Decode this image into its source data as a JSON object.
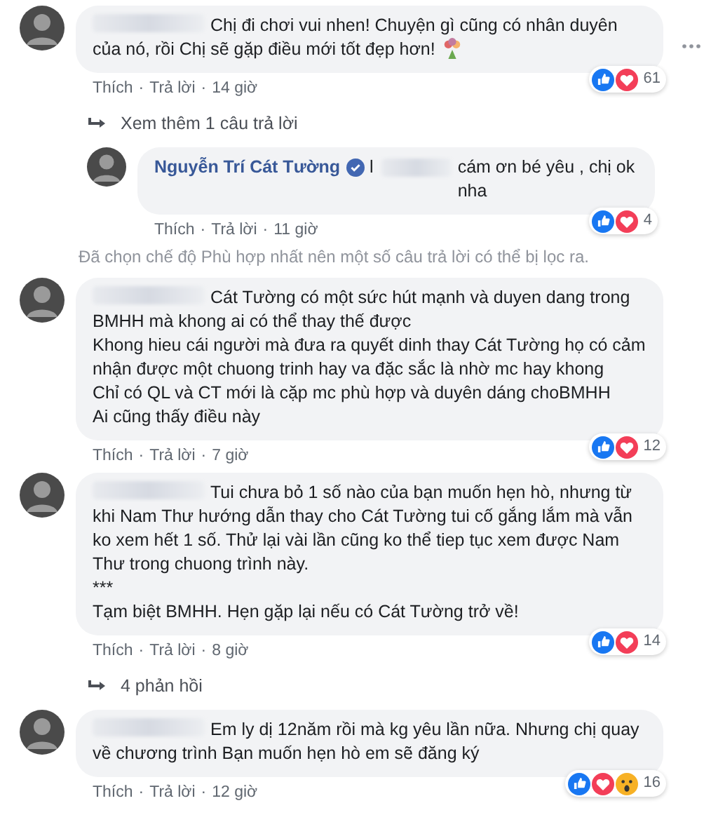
{
  "thread": [
    {
      "kind": "comment",
      "redacted_name": true,
      "text": "Chị đi chơi vui nhen! Chuyện gì cũng có nhân duyên của nó, rồi Chị sẽ gặp điều mới tốt đẹp hơn!",
      "trailing_emoji": true,
      "more_menu": true,
      "reactions": [
        {
          "kind": "like"
        },
        {
          "kind": "love"
        }
      ],
      "count": "61",
      "separators": [
        "·",
        "·"
      ],
      "like": "Thích",
      "reply": "Trả lời",
      "time": "14 giờ"
    },
    {
      "kind": "replies_link",
      "label": "Xem thêm 1 câu trả lời"
    },
    {
      "kind": "reply",
      "name": "Nguyễn Trí Cát Tường",
      "verified": true,
      "lead": "l",
      "redacted_name": true,
      "text": "cám ơn bé yêu , chị ok nha",
      "reactions": [
        {
          "kind": "like"
        },
        {
          "kind": "love"
        }
      ],
      "count": "4",
      "separators": [
        "·",
        "·"
      ],
      "like": "Thích",
      "reply": "Trả lời",
      "time": "11 giờ"
    },
    {
      "kind": "notice",
      "label": "Đã chọn chế độ Phù hợp nhất nên một số câu trả lời có thể bị lọc ra."
    },
    {
      "kind": "comment",
      "redacted_name": true,
      "text": "Cát Tường có một sức hút mạnh và duyen dang trong BMHH mà khong ai có thể thay thế được\nKhong hieu cái người mà đưa ra quyết dinh thay Cát Tường họ có cảm nhận được một chuong trinh hay va đặc sắc là nhờ mc hay khong\nChỉ có QL và CT mới là cặp mc phù hợp và duyên dáng choBMHH\nAi cũng thấy điều này",
      "reactions": [
        {
          "kind": "like"
        },
        {
          "kind": "love"
        }
      ],
      "count": "12",
      "separators": [
        "·",
        "·"
      ],
      "like": "Thích",
      "reply": "Trả lời",
      "time": "7 giờ"
    },
    {
      "kind": "comment",
      "redacted_name": true,
      "text": "Tui chưa bỏ 1 số nào của bạn muốn hẹn hò, nhưng từ khi Nam Thư hướng dẫn thay cho Cát Tường tui cố gắng lắm mà vẫn ko xem hết 1 số. Thử lại vài lần cũng ko thể tiep tục xem được Nam Thư trong chuong trình này.\n***\nTạm biệt BMHH. Hẹn gặp lại nếu có Cát Tường trở về!",
      "reactions": [
        {
          "kind": "like"
        },
        {
          "kind": "love"
        }
      ],
      "count": "14",
      "separators": [
        "·",
        "·"
      ],
      "like": "Thích",
      "reply": "Trả lời",
      "time": "8 giờ"
    },
    {
      "kind": "replies_link",
      "label": "4 phản hồi"
    },
    {
      "kind": "comment",
      "redacted_name": true,
      "text": "Em ly dị 12năm rồi mà kg yêu lần nữa. Nhưng chị quay về chương trình Bạn muốn hẹn hò em sẽ đăng ký",
      "reactions": [
        {
          "kind": "like"
        },
        {
          "kind": "love"
        },
        {
          "kind": "wow"
        }
      ],
      "count": "16",
      "separators": [
        "·",
        "·"
      ],
      "like": "Thích",
      "reply": "Trả lời",
      "time": "12 giờ"
    }
  ]
}
